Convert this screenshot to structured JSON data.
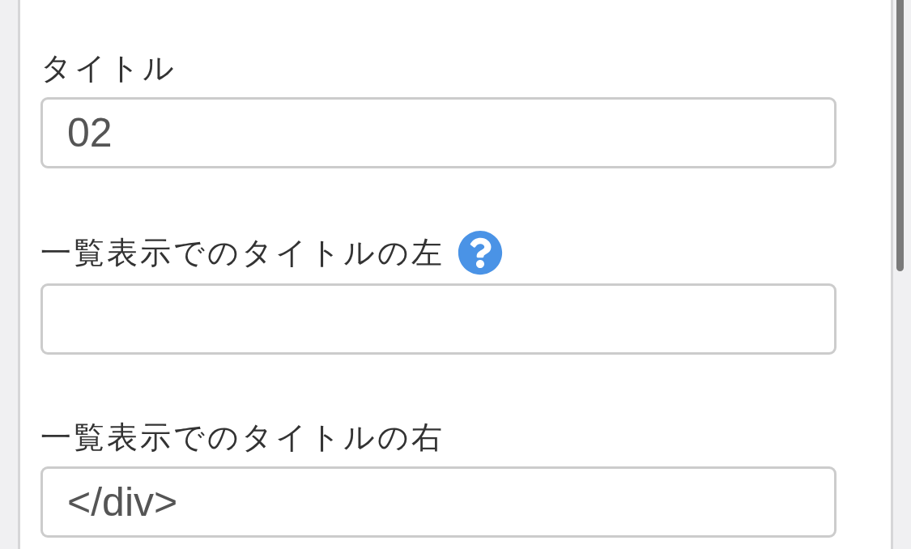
{
  "fields": [
    {
      "label": "タイトル",
      "value": "02",
      "help": false
    },
    {
      "label": "一覧表示でのタイトルの左",
      "help": true
    },
    {
      "label": "一覧表示でのタイトルの右",
      "value": "</div>",
      "help": false
    }
  ]
}
